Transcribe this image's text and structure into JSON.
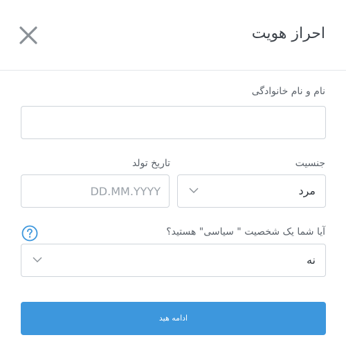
{
  "header": {
    "title": "احراز هویت",
    "close_icon": "close-icon"
  },
  "form": {
    "full_name": {
      "label": "نام و نام خانوادگی",
      "value": "",
      "placeholder": ""
    },
    "gender": {
      "label": "جنسیت",
      "selected": "مرد",
      "icon": "chevron-down-icon"
    },
    "birth_date": {
      "label": "تاریخ تولد",
      "value": "",
      "placeholder": "DD.MM.YYYY"
    },
    "political": {
      "label": "آیا شما یک شخصیت \" سیاسی\" هستید؟",
      "selected": "نه",
      "help_icon": "question-circle-icon",
      "icon": "chevron-down-icon"
    },
    "submit_label": "ادامه هید"
  },
  "colors": {
    "accent": "#3d97dd",
    "border": "#cfd4da",
    "close_icon": "#8a9096"
  }
}
